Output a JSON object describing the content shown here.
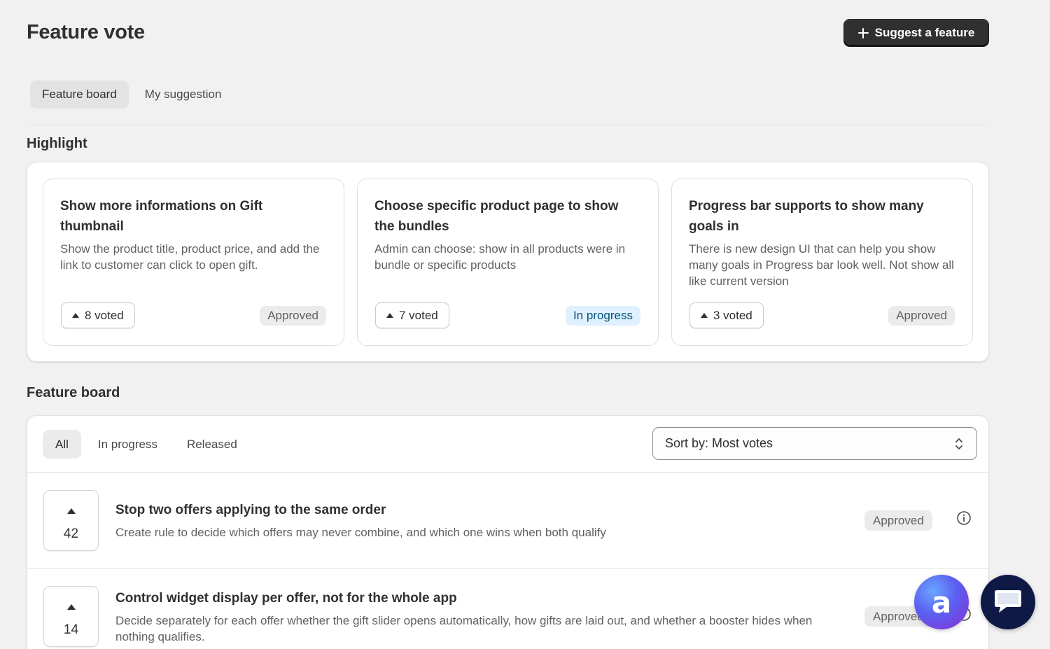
{
  "header": {
    "title": "Feature vote",
    "suggest_label": "Suggest a feature"
  },
  "tabs": [
    {
      "label": "Feature board",
      "active": true
    },
    {
      "label": "My suggestion",
      "active": false
    }
  ],
  "highlight": {
    "title": "Highlight",
    "cards": [
      {
        "title": "Show more informations on Gift thumbnail",
        "description": "Show the product title, product price, and add the link to customer can click to open gift.",
        "votes": "8 voted",
        "status": "Approved"
      },
      {
        "title": "Choose specific product page to show the bundles",
        "description": "Admin can choose: show in all products were in bundle or specific products",
        "votes": "7 voted",
        "status": "In progress"
      },
      {
        "title": "Progress bar supports to show many goals in",
        "description": "There is new design UI that can help you show many goals in Progress bar look well. Not show all like current version",
        "votes": "3 voted",
        "status": "Approved"
      }
    ]
  },
  "board": {
    "title": "Feature board",
    "filters": [
      {
        "label": "All",
        "active": true
      },
      {
        "label": "In progress",
        "active": false
      },
      {
        "label": "Released",
        "active": false
      }
    ],
    "sort_label": "Sort by: Most votes",
    "rows": [
      {
        "votes": "42",
        "title": "Stop two offers applying to the same order",
        "description": "Create rule to decide which offers may never combine, and which one wins when both qualify",
        "status": "Approved"
      },
      {
        "votes": "14",
        "title": "Control widget display per offer, not for the whole app",
        "description": "Decide separately for each offer whether the gift slider opens automatically, how gifts are laid out, and whether a booster hides when nothing qualifies.",
        "status": "Approved"
      }
    ]
  },
  "widgets": {
    "assistant_glyph": "a",
    "chat_icon": "chat-bubble-icon"
  },
  "colors": {
    "primary_button": "#303030",
    "in_progress_bg": "#e0f0ff",
    "in_progress_text": "#00527c",
    "approved_bg": "#ebebeb",
    "chat_bg": "#0e1a45"
  }
}
